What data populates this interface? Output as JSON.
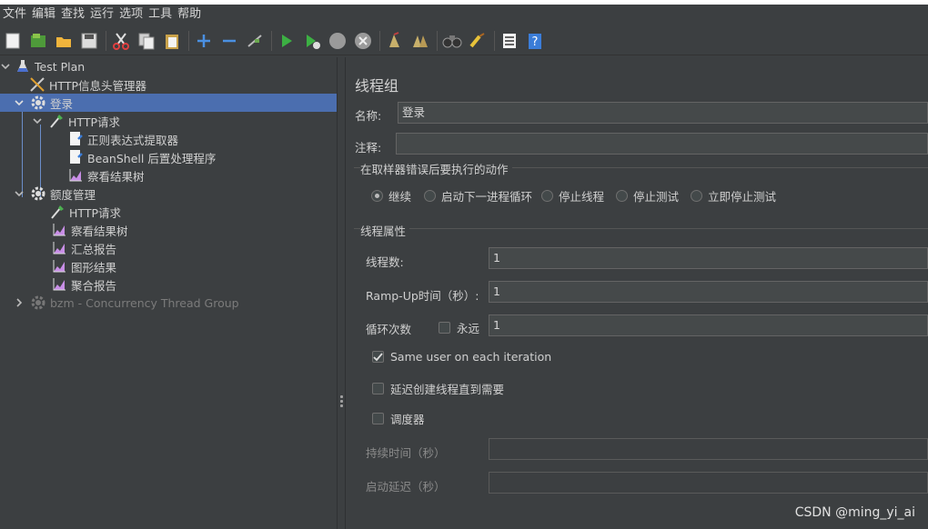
{
  "menu": [
    "文件",
    "编辑",
    "查找",
    "运行",
    "选项",
    "工具",
    "帮助"
  ],
  "toolbar": {
    "icons": [
      "new-icon",
      "templates-icon",
      "open-icon",
      "save-icon",
      "cut-icon",
      "copy-icon",
      "paste-icon",
      "expand-icon",
      "collapse-icon",
      "toggle-icon",
      "start-icon",
      "start-no-pauses-icon",
      "stop-icon",
      "shutdown-icon",
      "clear-icon",
      "clear-all-icon",
      "search-icon",
      "reset-search-icon",
      "function-helper-icon",
      "help-icon"
    ]
  },
  "tree": {
    "items": [
      {
        "label": "Test Plan",
        "icon": "flask-icon",
        "level": 0,
        "expanded": true
      },
      {
        "label": "HTTP信息头管理器",
        "icon": "tools-icon",
        "level": 1
      },
      {
        "label": "登录",
        "icon": "gear-icon",
        "level": 1,
        "expanded": true,
        "selected": true
      },
      {
        "label": "HTTP请求",
        "icon": "pipette-icon",
        "level": 2,
        "expanded": true
      },
      {
        "label": "正则表达式提取器",
        "icon": "doc-icon",
        "level": 3
      },
      {
        "label": "BeanShell 后置处理程序",
        "icon": "doc-icon",
        "level": 3
      },
      {
        "label": "察看结果树",
        "icon": "graph-icon",
        "level": 3
      },
      {
        "label": "额度管理",
        "icon": "gear-icon",
        "level": 1,
        "expanded": true
      },
      {
        "label": "HTTP请求",
        "icon": "pipette-icon",
        "level": 2
      },
      {
        "label": "察看结果树",
        "icon": "graph-icon",
        "level": 2
      },
      {
        "label": "汇总报告",
        "icon": "graph-icon",
        "level": 2
      },
      {
        "label": "图形结果",
        "icon": "graph-icon",
        "level": 2
      },
      {
        "label": "聚合报告",
        "icon": "graph-icon",
        "level": 2
      },
      {
        "label": "bzm - Concurrency Thread Group",
        "icon": "gear-icon",
        "level": 1,
        "collapsed": true,
        "disabled": true
      }
    ]
  },
  "panel": {
    "title": "线程组",
    "name_label": "名称:",
    "name_value": "登录",
    "comment_label": "注释:",
    "comment_value": "",
    "error_action": {
      "title": "在取样器错误后要执行的动作",
      "options": [
        "继续",
        "启动下一进程循环",
        "停止线程",
        "停止测试",
        "立即停止测试"
      ],
      "selected": "继续"
    },
    "thread_props": {
      "title": "线程属性",
      "threads_label": "线程数:",
      "threads_value": "1",
      "rampup_label": "Ramp-Up时间（秒）:",
      "rampup_value": "1",
      "loop_label": "循环次数",
      "forever_label": "永远",
      "forever_checked": false,
      "loop_value": "1",
      "same_user_label": "Same user on each iteration",
      "same_user_checked": true,
      "delay_label": "延迟创建线程直到需要",
      "delay_checked": false,
      "scheduler_label": "调度器",
      "scheduler_checked": false,
      "duration_label": "持续时间（秒）",
      "duration_value": "",
      "startup_delay_label": "启动延迟（秒）",
      "startup_delay_value": ""
    }
  },
  "watermark": "CSDN @ming_yi_ai"
}
